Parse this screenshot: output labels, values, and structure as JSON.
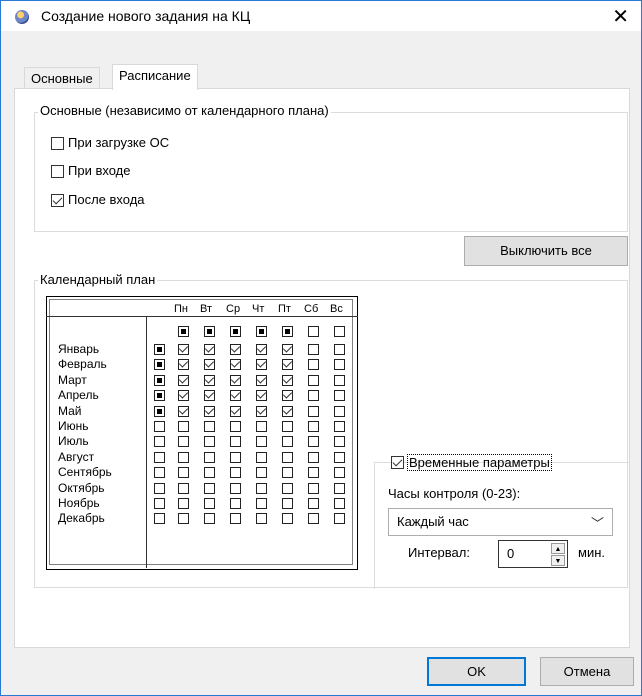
{
  "window": {
    "title": "Создание нового задания на КЦ",
    "close_symbol": "✕"
  },
  "tabs": [
    {
      "label": "Основные"
    },
    {
      "label": "Расписание"
    }
  ],
  "basic_group": {
    "legend": "Основные (независимо от календарного плана)",
    "options": [
      {
        "label": "При загрузке ОС",
        "checked": false
      },
      {
        "label": "При входе",
        "checked": false
      },
      {
        "label": "После входа",
        "checked": true
      }
    ]
  },
  "disable_all_label": "Выключить все",
  "calendar": {
    "legend": "Календарный план",
    "days": [
      "Пн",
      "Вт",
      "Ср",
      "Чт",
      "Пт",
      "Сб",
      "Вс"
    ],
    "months": [
      "Январь",
      "Февраль",
      "Март",
      "Апрель",
      "Май",
      "Июнь",
      "Июль",
      "Август",
      "Сентябрь",
      "Октябрь",
      "Ноябрь",
      "Декабрь"
    ],
    "day_header_selected": [
      true,
      true,
      true,
      true,
      true,
      false,
      false
    ],
    "month_selected": [
      true,
      true,
      true,
      true,
      true,
      false,
      false,
      false,
      false,
      false,
      false,
      false
    ],
    "checked": [
      [
        true,
        true,
        true,
        true,
        true,
        false,
        false
      ],
      [
        true,
        true,
        true,
        true,
        true,
        false,
        false
      ],
      [
        true,
        true,
        true,
        true,
        true,
        false,
        false
      ],
      [
        true,
        true,
        true,
        true,
        true,
        false,
        false
      ],
      [
        true,
        true,
        true,
        true,
        true,
        false,
        false
      ],
      [
        false,
        false,
        false,
        false,
        false,
        false,
        false
      ],
      [
        false,
        false,
        false,
        false,
        false,
        false,
        false
      ],
      [
        false,
        false,
        false,
        false,
        false,
        false,
        false
      ],
      [
        false,
        false,
        false,
        false,
        false,
        false,
        false
      ],
      [
        false,
        false,
        false,
        false,
        false,
        false,
        false
      ],
      [
        false,
        false,
        false,
        false,
        false,
        false,
        false
      ],
      [
        false,
        false,
        false,
        false,
        false,
        false,
        false
      ]
    ]
  },
  "time_params": {
    "label": "Временные параметры",
    "checked": true,
    "hours_label": "Часы контроля (0-23):",
    "hours_value": "Каждый час",
    "interval_label": "Интервал:",
    "interval_value": "0",
    "interval_unit": "мин."
  },
  "buttons": {
    "ok": "OK",
    "cancel": "Отмена"
  },
  "colors": {
    "accent": "#0078d7",
    "window_border": "#2b79d6"
  }
}
